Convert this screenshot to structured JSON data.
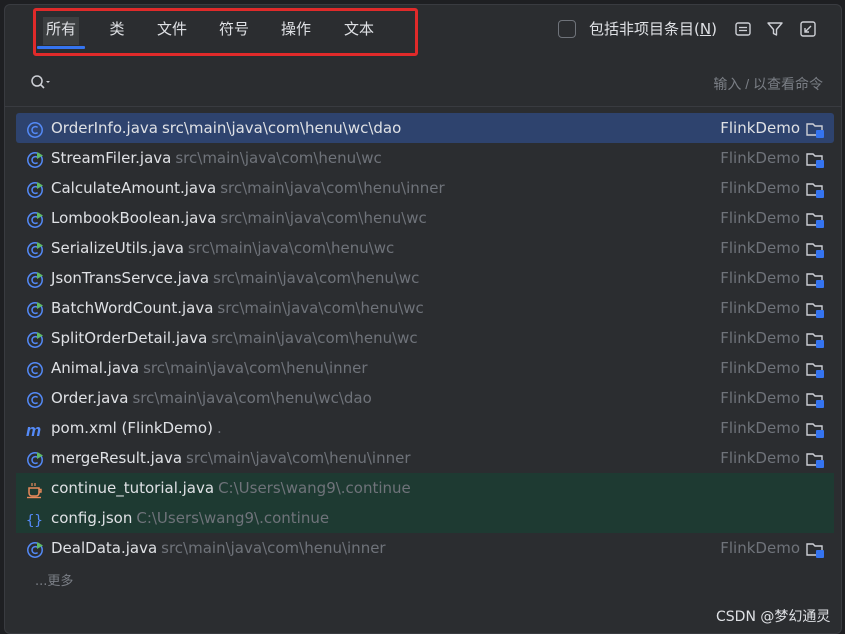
{
  "tabs": [
    {
      "label": "所有",
      "active": true
    },
    {
      "label": "类",
      "active": false
    },
    {
      "label": "文件",
      "active": false
    },
    {
      "label": "符号",
      "active": false
    },
    {
      "label": "操作",
      "active": false
    },
    {
      "label": "文本",
      "active": false
    }
  ],
  "include_non_project": {
    "label": "包括非项目条目",
    "mnemonic": "N",
    "checked": false
  },
  "toolbar_icons": [
    "preview-icon",
    "filter-icon",
    "open-in-tool-window-icon"
  ],
  "search": {
    "value": "",
    "placeholder": "输入 / 以查看命令"
  },
  "results": [
    {
      "icon": "class-icon",
      "name": "OrderInfo.java",
      "path": "src\\main\\java\\com\\henu\\wc\\dao",
      "project": "FlinkDemo",
      "selected": true
    },
    {
      "icon": "runnable-class-icon",
      "name": "StreamFiler.java",
      "path": "src\\main\\java\\com\\henu\\wc",
      "project": "FlinkDemo"
    },
    {
      "icon": "runnable-class-icon",
      "name": "CalculateAmount.java",
      "path": "src\\main\\java\\com\\henu\\inner",
      "project": "FlinkDemo"
    },
    {
      "icon": "runnable-class-icon",
      "name": "LombookBoolean.java",
      "path": "src\\main\\java\\com\\henu\\wc",
      "project": "FlinkDemo"
    },
    {
      "icon": "runnable-class-icon",
      "name": "SerializeUtils.java",
      "path": "src\\main\\java\\com\\henu\\wc",
      "project": "FlinkDemo"
    },
    {
      "icon": "runnable-class-icon",
      "name": "JsonTransServce.java",
      "path": "src\\main\\java\\com\\henu\\wc",
      "project": "FlinkDemo"
    },
    {
      "icon": "runnable-class-icon",
      "name": "BatchWordCount.java",
      "path": "src\\main\\java\\com\\henu\\wc",
      "project": "FlinkDemo"
    },
    {
      "icon": "runnable-class-icon",
      "name": "SplitOrderDetail.java",
      "path": "src\\main\\java\\com\\henu\\wc",
      "project": "FlinkDemo"
    },
    {
      "icon": "class-icon",
      "name": "Animal.java",
      "path": "src\\main\\java\\com\\henu\\inner",
      "project": "FlinkDemo"
    },
    {
      "icon": "class-icon",
      "name": "Order.java",
      "path": "src\\main\\java\\com\\henu\\wc\\dao",
      "project": "FlinkDemo"
    },
    {
      "icon": "maven-icon",
      "name": "pom.xml (FlinkDemo)",
      "path": ".",
      "project": "FlinkDemo"
    },
    {
      "icon": "runnable-class-icon",
      "name": "mergeResult.java",
      "path": "src\\main\\java\\com\\henu\\inner",
      "project": "FlinkDemo"
    },
    {
      "icon": "java-file-icon",
      "name": "continue_tutorial.java",
      "path": "C:\\Users\\wang9\\.continue",
      "project": "",
      "external": true
    },
    {
      "icon": "json-file-icon",
      "name": "config.json",
      "path": "C:\\Users\\wang9\\.continue",
      "project": "",
      "external": true
    },
    {
      "icon": "runnable-class-icon",
      "name": "DealData.java",
      "path": "src\\main\\java\\com\\henu\\inner",
      "project": "FlinkDemo"
    }
  ],
  "more_label": "...更多",
  "watermark": "CSDN @梦幻通灵",
  "colors": {
    "selection": "#2e436e",
    "accent": "#3574f0",
    "external_row": "#1e3a32",
    "frame": "#e02a2a"
  }
}
